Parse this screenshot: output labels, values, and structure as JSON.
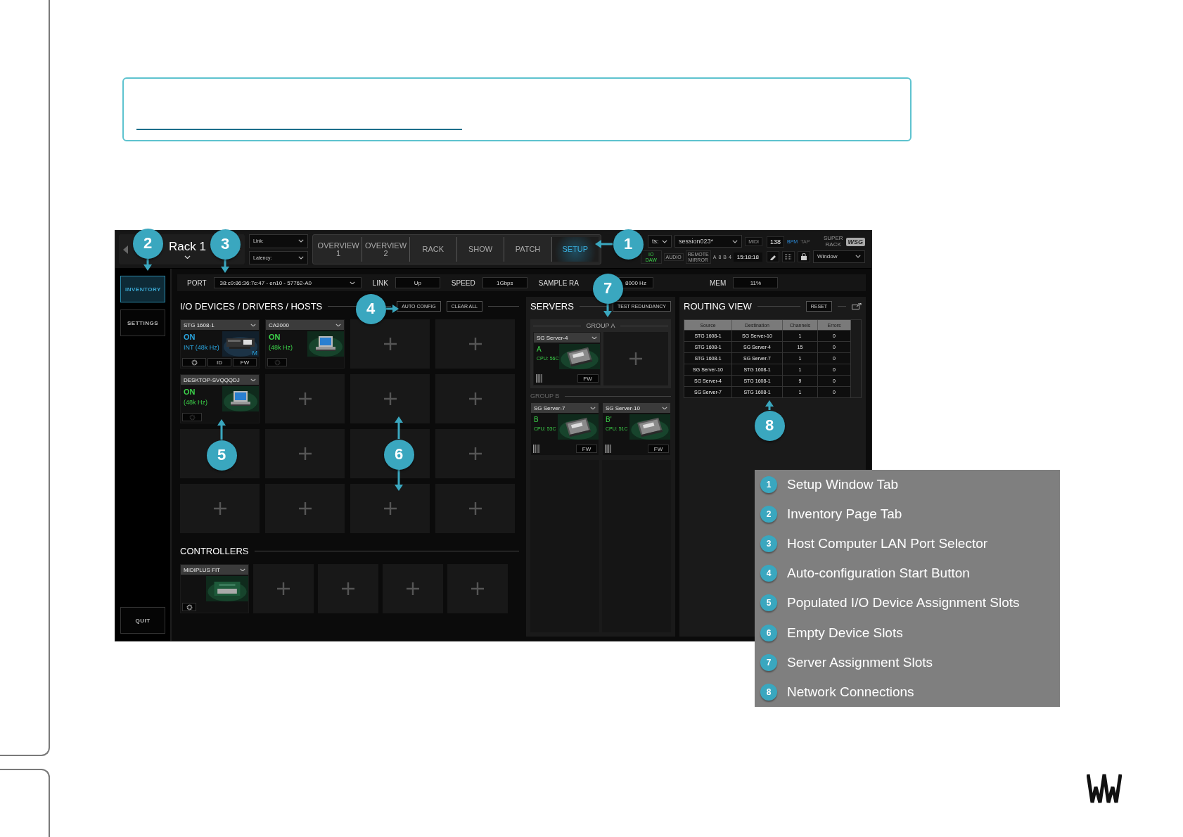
{
  "screen": {
    "rack": {
      "title": "Rack 1"
    },
    "selectors": [
      {
        "label": "Link:"
      },
      {
        "label": "Latency:"
      }
    ],
    "tabs": [
      {
        "label": "OVERVIEW\n1",
        "selected": false
      },
      {
        "label": "OVERVIEW\n2",
        "selected": false
      },
      {
        "label": "RACK",
        "selected": false
      },
      {
        "label": "SHOW",
        "selected": false
      },
      {
        "label": "PATCH",
        "selected": false
      },
      {
        "label": "SETUP",
        "selected": true
      }
    ],
    "preset": "ts:",
    "session": "session023*",
    "midi": "MIDI",
    "bpm": "138",
    "bpm_unit": "BPM",
    "tap": "TAP",
    "brand": "SUPER\nRACK",
    "brand_badge": "WSG",
    "indicators": [
      {
        "text": "IO DAW",
        "on": true
      },
      {
        "text": "AUDIO",
        "on": false
      },
      {
        "text": "REMOTE\nMIRROR",
        "on": false
      }
    ],
    "meters": [
      {
        "label": "A",
        "value": "8"
      },
      {
        "label": "B",
        "value": "4"
      }
    ],
    "clock": "15:18:18",
    "window": "Window",
    "sidebar": [
      {
        "label": "INVENTORY",
        "selected": true
      },
      {
        "label": "SETTINGS",
        "selected": false
      }
    ],
    "quit": "QUIT",
    "port": {
      "label": "PORT",
      "value": "38:c9:86:36:7c:47 - en10 - 57762-A0"
    },
    "stats": [
      {
        "label": "LINK",
        "value": "Up"
      },
      {
        "label": "SPEED",
        "value": "1Gbps"
      },
      {
        "label": "SAMPLE RA",
        "value": "8000 Hz"
      },
      {
        "label": "MEM",
        "value": "11%"
      }
    ],
    "io": {
      "title": "I/O DEVICES / DRIVERS / HOSTS",
      "buttons": [
        "AUTO CONFIG",
        "CLEAR ALL"
      ],
      "slots": [
        {
          "kind": "device",
          "name": "STG 1608-1",
          "status": "ON",
          "rate": "INT (48k Hz)",
          "color": "#2aa6e0",
          "badge": "M",
          "buttons": [
            "ID",
            "FW"
          ]
        },
        {
          "kind": "device",
          "name": "CA2000",
          "status": "ON",
          "rate": "(48k Hz)",
          "color": "#3cd24a"
        },
        {
          "kind": "empty"
        },
        {
          "kind": "empty"
        },
        {
          "kind": "device",
          "name": "DESKTOP-SVQQQDJ",
          "status": "ON",
          "rate": "(48k Hz)",
          "color": "#3cd24a"
        },
        {
          "kind": "empty"
        },
        {
          "kind": "empty"
        },
        {
          "kind": "empty"
        },
        {
          "kind": "empty",
          "plus": false
        },
        {
          "kind": "empty"
        },
        {
          "kind": "empty",
          "plus": false
        },
        {
          "kind": "empty"
        },
        {
          "kind": "empty"
        },
        {
          "kind": "empty"
        },
        {
          "kind": "empty"
        },
        {
          "kind": "empty"
        }
      ]
    },
    "controllers": {
      "title": "CONTROLLERS",
      "slots": [
        {
          "kind": "controller",
          "name": "MIDIPLUS FIT"
        },
        {
          "kind": "empty"
        },
        {
          "kind": "empty"
        },
        {
          "kind": "empty"
        },
        {
          "kind": "empty"
        }
      ]
    },
    "servers": {
      "title": "SERVERS",
      "button": "TEST REDUNDANCY",
      "groups": [
        {
          "title": "GROUP A",
          "active": true,
          "slots": [
            {
              "kind": "server",
              "name": "SG Server-4",
              "role": "A",
              "cpu": "CPU: 56C",
              "fw": "FW"
            },
            {
              "kind": "empty"
            }
          ]
        },
        {
          "title": "GROUP B",
          "active": false,
          "slots": [
            {
              "kind": "server",
              "name": "SG Server-7",
              "role": "B",
              "cpu": "CPU: 53C",
              "fw": "FW"
            },
            {
              "kind": "server",
              "name": "SG Server-10",
              "role": "B'",
              "cpu": "CPU: 51C",
              "fw": "FW"
            }
          ]
        }
      ]
    },
    "routing": {
      "title": "ROUTING VIEW",
      "button": "RESET",
      "columns": [
        "Source",
        "Destination",
        "Channels",
        "Errors"
      ],
      "rows": [
        [
          "STG 1608-1",
          "SG Server-10",
          "1",
          "0"
        ],
        [
          "STG 1608-1",
          "SG Server-4",
          "15",
          "0"
        ],
        [
          "STG 1608-1",
          "SG Server-7",
          "1",
          "0"
        ],
        [
          "SG Server-10",
          "STG 1608-1",
          "1",
          "0"
        ],
        [
          "SG Server-4",
          "STG 1608-1",
          "9",
          "0"
        ],
        [
          "SG Server-7",
          "STG 1608-1",
          "1",
          "0"
        ]
      ]
    }
  },
  "callouts": [
    "2",
    "3",
    "1",
    "7",
    "4",
    "8",
    "5",
    "6"
  ],
  "legend": [
    {
      "number": "1",
      "text": "Setup Window Tab"
    },
    {
      "number": "2",
      "text": "Inventory Page Tab"
    },
    {
      "number": "3",
      "text": "Host Computer LAN Port Selector"
    },
    {
      "number": "4",
      "text": "Auto-configuration Start Button"
    },
    {
      "number": "5",
      "text": "Populated I/O Device Assignment Slots"
    },
    {
      "number": "6",
      "text": "Empty Device Slots"
    },
    {
      "number": "7",
      "text": "Server Assignment Slots"
    },
    {
      "number": "8",
      "text": "Network Connections"
    }
  ]
}
